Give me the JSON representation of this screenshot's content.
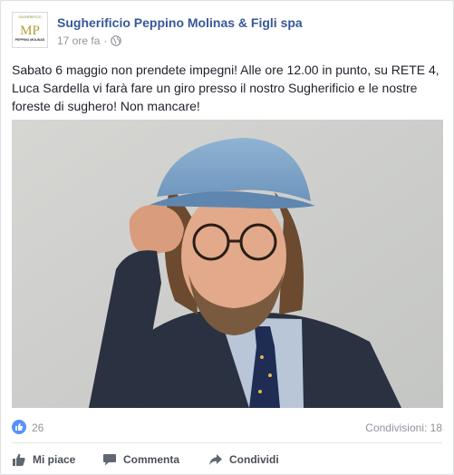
{
  "post": {
    "page_name": "Sugherificio Peppino Molinas & Figli spa",
    "timestamp": "17 ore fa",
    "privacy_icon": "globe-icon",
    "text": "Sabato 6 maggio non prendete impegni! Alle ore 12.00 in punto, su RETE 4, Luca Sardella vi farà fare un giro presso il nostro Sugherificio e le nostre foreste di sughero! Non mancare!",
    "logo": {
      "monogram": "MP",
      "top_text": "SUGHERIFICIO",
      "bottom_text": "PEPPINO MOLINAS"
    }
  },
  "stats": {
    "like_icon": "thumbs-up-icon",
    "likes": "26",
    "shares": "Condivisioni: 18"
  },
  "actions": {
    "like": "Mi piace",
    "comment": "Commenta",
    "share": "Condividi"
  },
  "colors": {
    "link": "#365899",
    "like_blue": "#5890ff",
    "muted": "#90949c"
  }
}
